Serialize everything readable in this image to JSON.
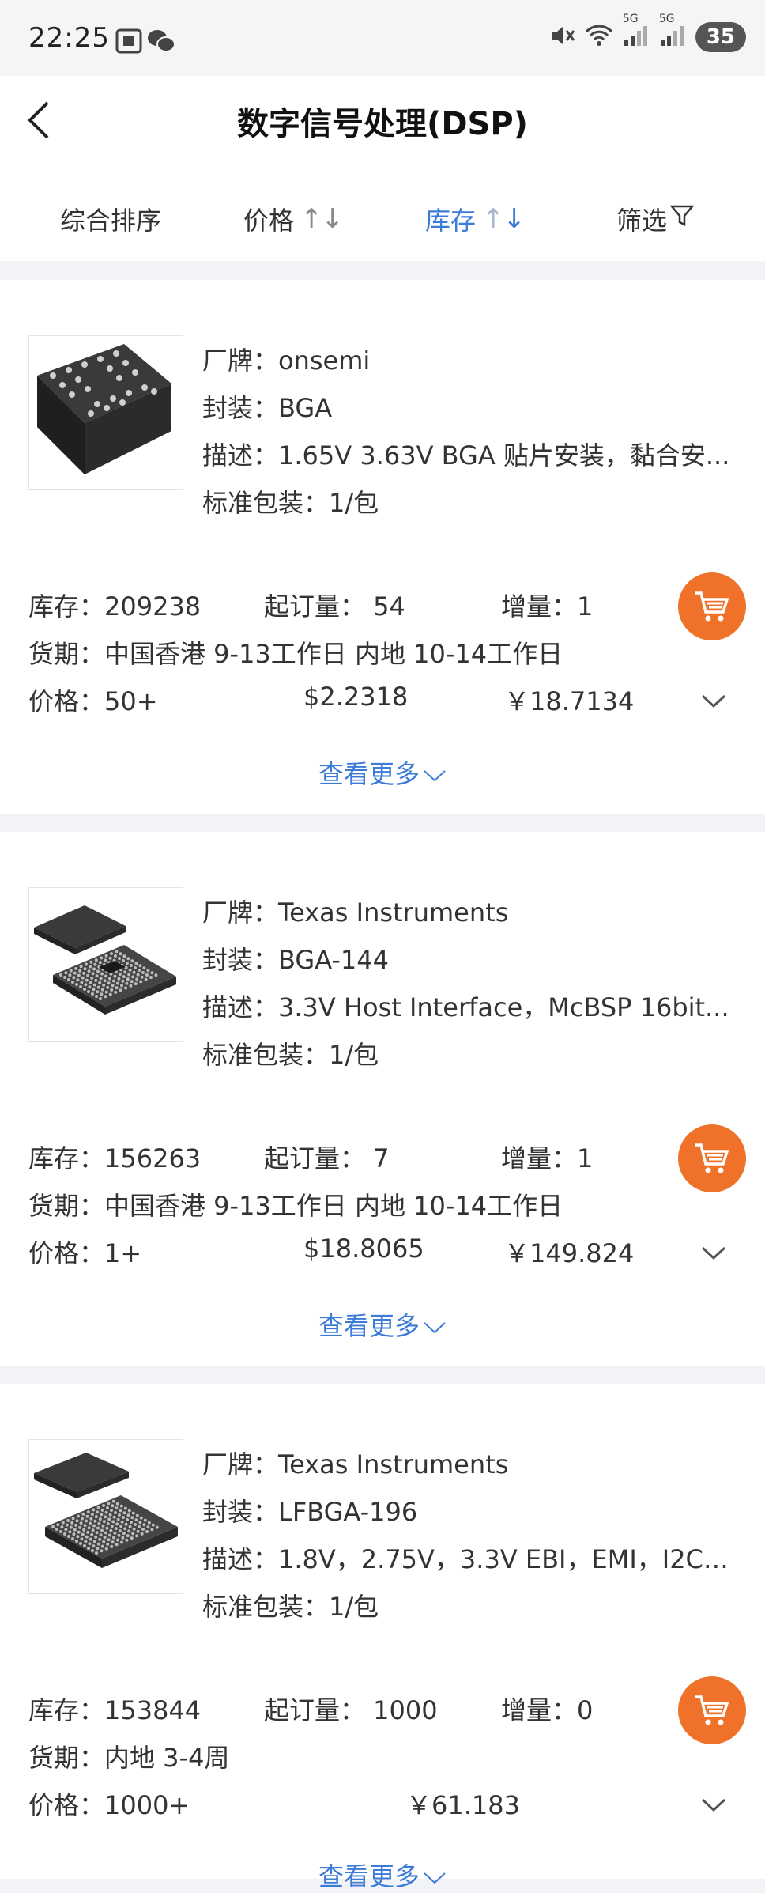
{
  "status_bar": {
    "time": "22:25",
    "battery": "35",
    "net1": "5G",
    "net2": "5G"
  },
  "header": {
    "title": "数字信号处理(DSP)"
  },
  "tabs": [
    {
      "label": "综合排序"
    },
    {
      "label": "价格",
      "arrows": "↑↓"
    },
    {
      "label": "库存",
      "arrows": "↑↓"
    },
    {
      "label": "筛选"
    }
  ],
  "products": [
    {
      "brand": "厂牌：onsemi",
      "package": "封装：BGA",
      "desc": "描述：1.65V 3.63V BGA 贴片安装，黏合安...",
      "std_pack": "标准包装：1/包",
      "stock": "库存：209238",
      "moq": "起订量： 54",
      "increment": "增量：1",
      "lead": "货期：中国香港 9-13工作日   内地 10-14工作日",
      "price_label": "价格：50+",
      "price_usd": "$2.2318",
      "price_cny": "￥18.7134",
      "more": "查看更多"
    },
    {
      "brand": "厂牌：Texas Instruments",
      "package": "封装：BGA-144",
      "desc": "描述：3.3V Host Interface，McBSP 16bit...",
      "std_pack": "标准包装：1/包",
      "stock": "库存：156263",
      "moq": "起订量： 7",
      "increment": "增量：1",
      "lead": "货期：中国香港 9-13工作日   内地 10-14工作日",
      "price_label": "价格：1+",
      "price_usd": "$18.8065",
      "price_cny": "￥149.824",
      "more": "查看更多"
    },
    {
      "brand": "厂牌：Texas Instruments",
      "package": "封装：LFBGA-196",
      "desc": "描述：1.8V，2.75V，3.3V EBI，EMI，I2C，...",
      "std_pack": "标准包装：1/包",
      "stock": "库存：153844",
      "moq": "起订量： 1000",
      "increment": "增量：0",
      "lead": "货期：内地 3-4周",
      "price_label": "价格：1000+",
      "price_usd": "",
      "price_cny": "￥61.183",
      "more": "查看更多"
    }
  ],
  "colors": {
    "accent": "#3d7bd9",
    "cart": "#f0722a",
    "background": "#f2f3f7"
  }
}
